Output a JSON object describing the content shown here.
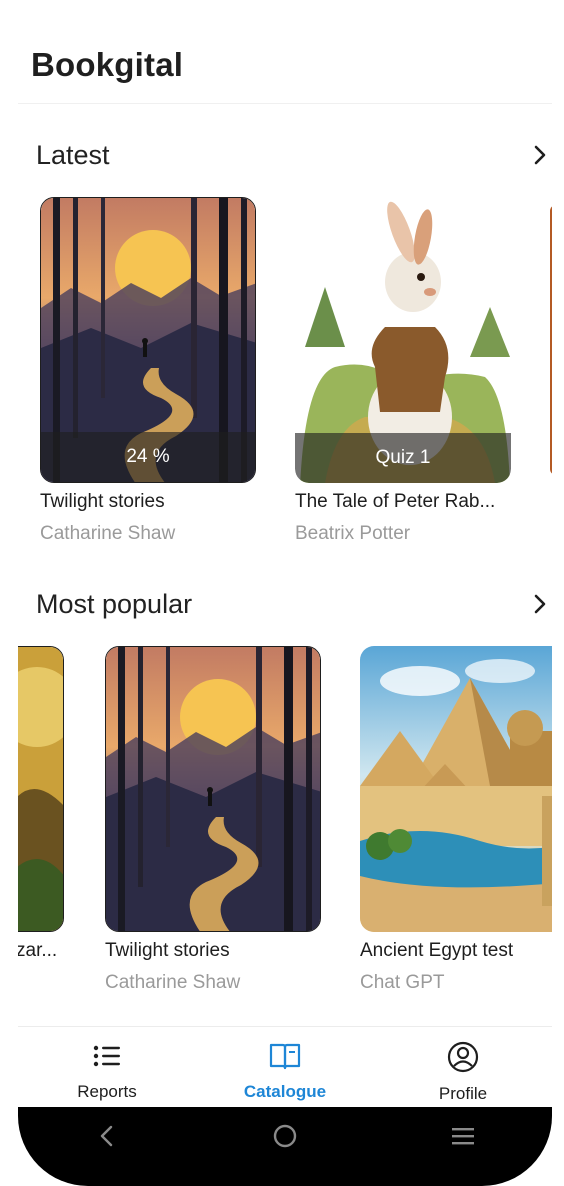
{
  "app": {
    "title": "Bookgital"
  },
  "sections": {
    "latest": {
      "title": "Latest",
      "items": [
        {
          "title": "Twilight stories",
          "author": "Catharine Shaw",
          "badge": "24 %"
        },
        {
          "title": "The Tale of Peter Rab...",
          "author": "Beatrix Potter",
          "badge": "Quiz 1"
        }
      ]
    },
    "popular": {
      "title": "Most popular",
      "items": [
        {
          "title": "zar...",
          "author": ""
        },
        {
          "title": "Twilight stories",
          "author": "Catharine Shaw"
        },
        {
          "title": "Ancient Egypt test",
          "author": "Chat GPT"
        }
      ]
    }
  },
  "nav": {
    "items": [
      {
        "label": "Reports",
        "icon": "list-icon"
      },
      {
        "label": "Catalogue",
        "icon": "book-icon",
        "active": true
      },
      {
        "label": "Profile",
        "icon": "profile-icon"
      }
    ]
  },
  "colors": {
    "accent": "#1e86d6",
    "text": "#1e1e1e",
    "muted": "#9a9a9a"
  }
}
